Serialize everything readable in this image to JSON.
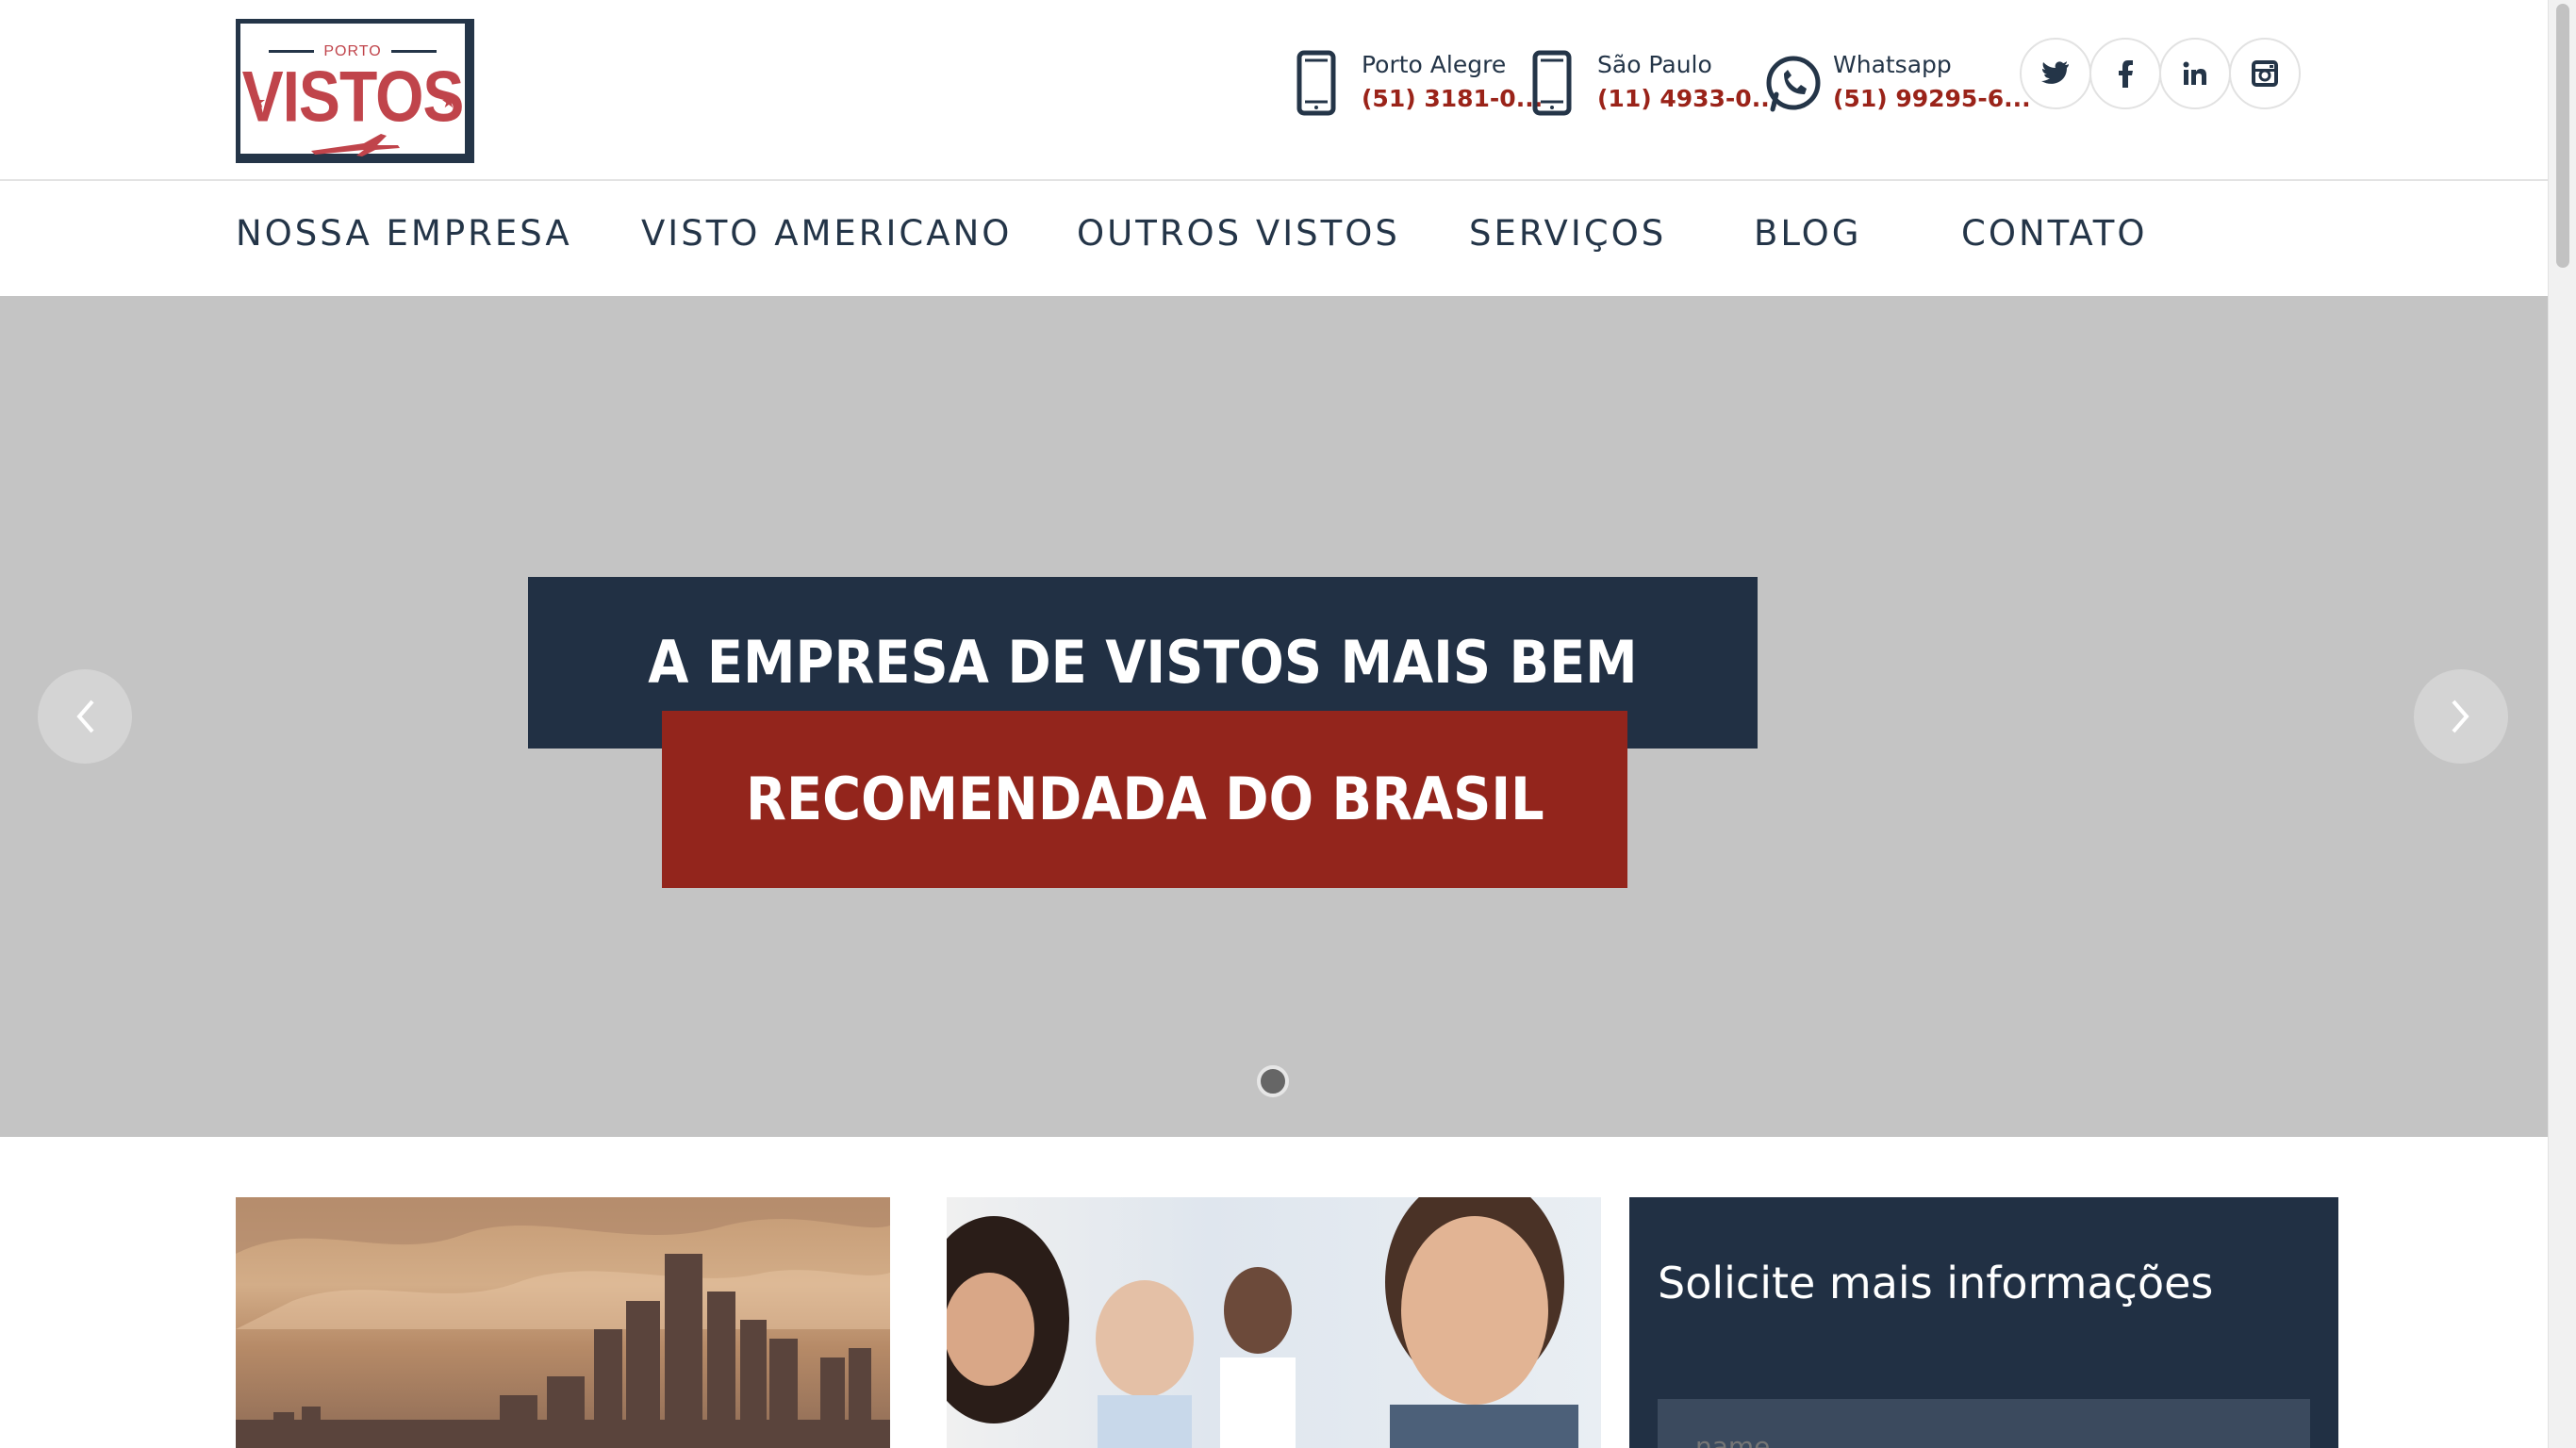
{
  "brand": {
    "porto": "PORTO",
    "vistos": "VISTOS"
  },
  "contacts": [
    {
      "city": "Porto Alegre",
      "number": "(51) 3181-0...",
      "icon": "phone-icon"
    },
    {
      "city": "São Paulo",
      "number": "(11) 4933-0...",
      "icon": "phone-icon"
    },
    {
      "city": "Whatsapp",
      "number": "(51) 99295-6...",
      "icon": "whatsapp-icon"
    }
  ],
  "social": [
    "twitter-icon",
    "facebook-icon",
    "linkedin-icon",
    "instagram-icon"
  ],
  "nav": [
    "NOSSA EMPRESA",
    "VISTO AMERICANO",
    "OUTROS VISTOS",
    "SERVIÇOS",
    "BLOG",
    "CONTATO"
  ],
  "hero": {
    "line1": "A EMPRESA DE VISTOS MAIS BEM",
    "line2": "RECOMENDADA DO BRASIL",
    "slides": 1,
    "active_slide": 1
  },
  "form": {
    "title": "Solicite mais informações",
    "name_placeholder": "name"
  },
  "colors": {
    "navy": "#213044",
    "red": "#93251c",
    "accent_text": "#9a2319"
  }
}
